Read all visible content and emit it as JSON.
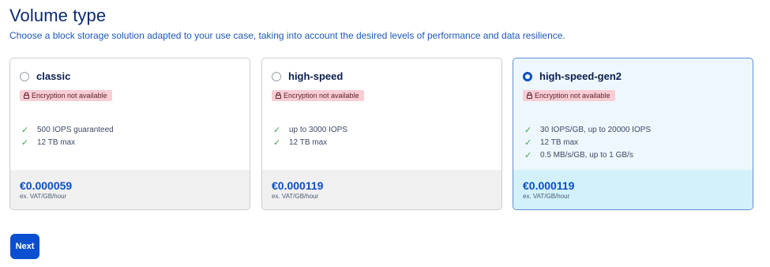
{
  "header": {
    "title": "Volume type",
    "subtitle": "Choose a block storage solution adapted to your use case, taking into account the desired levels of performance and data resilience."
  },
  "cards": [
    {
      "name": "classic",
      "selected": false,
      "badge": "Encryption not available",
      "features": [
        "500 IOPS guaranteed",
        "12 TB max"
      ],
      "price": "€0.000059",
      "unit": "ex. VAT/GB/hour"
    },
    {
      "name": "high-speed",
      "selected": false,
      "badge": "Encryption not available",
      "features": [
        "up to 3000 IOPS",
        "12 TB max"
      ],
      "price": "€0.000119",
      "unit": "ex. VAT/GB/hour"
    },
    {
      "name": "high-speed-gen2",
      "selected": true,
      "badge": "Encryption not available",
      "features": [
        "30 IOPS/GB, up to 20000 IOPS",
        "12 TB max",
        "0.5 MB/s/GB, up to 1 GB/s"
      ],
      "price": "€0.000119",
      "unit": "ex. VAT/GB/hour"
    }
  ],
  "actions": {
    "next_label": "Next"
  },
  "colors": {
    "accent": "#0b4fd1",
    "selected_bg": "#d2f1fb",
    "badge_bg": "#f8cdd4",
    "check": "#3ea34a"
  },
  "icons": {
    "badge": "lock-icon",
    "feature": "check-icon"
  }
}
